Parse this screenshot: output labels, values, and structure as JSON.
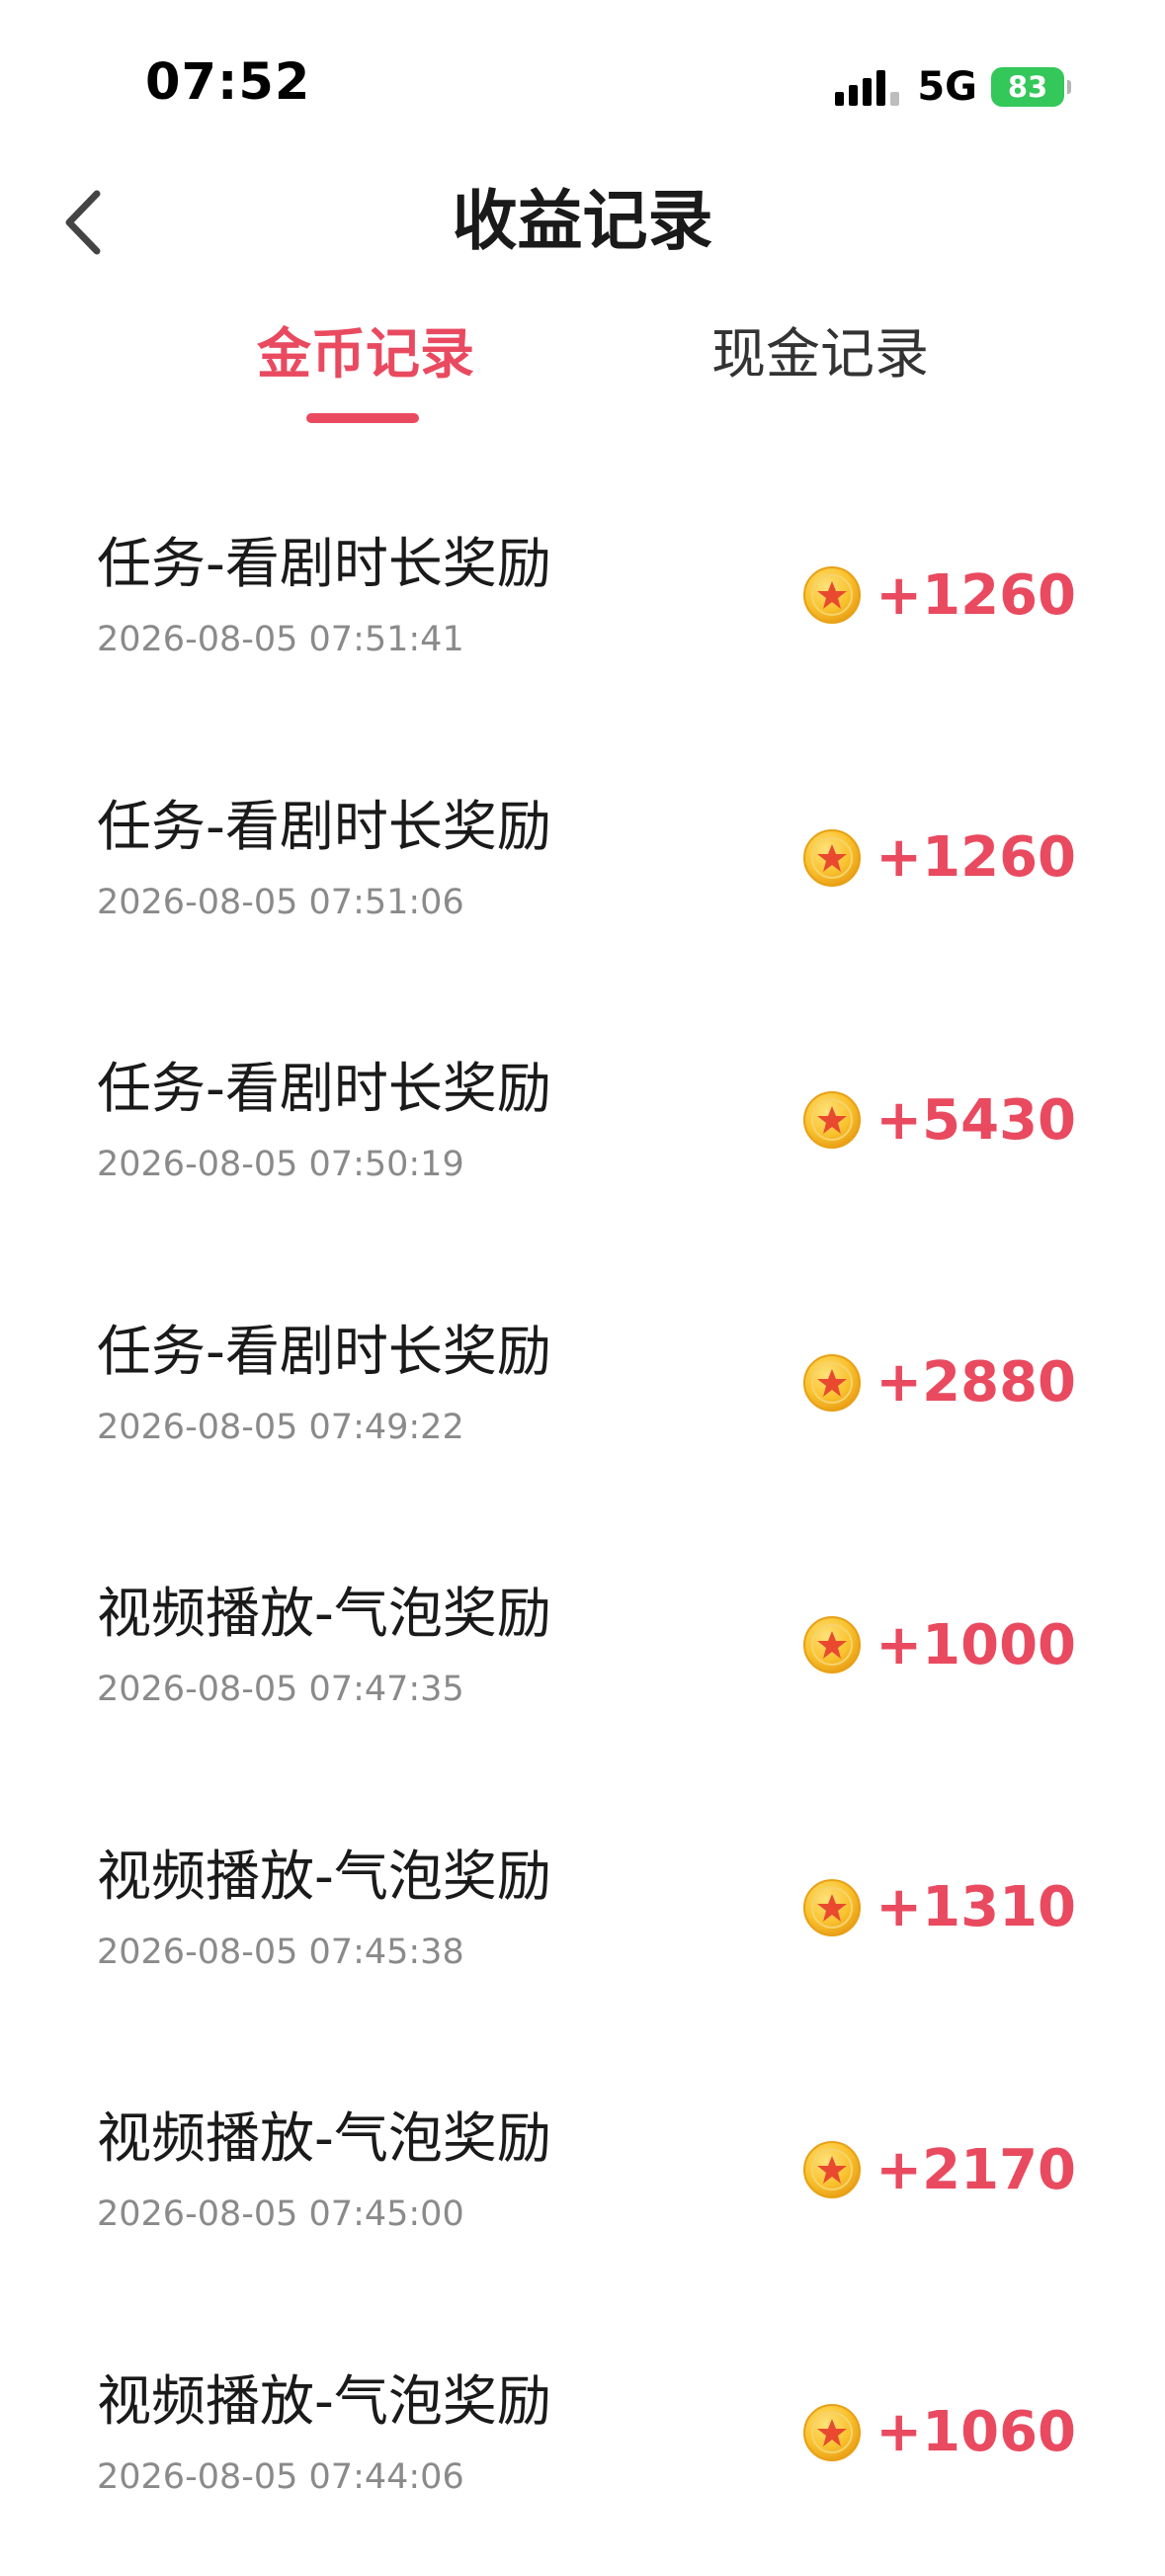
{
  "status_bar": {
    "time": "07:52",
    "network": "5G",
    "battery": "83",
    "signal_icon": "cellular-signal-icon",
    "battery_icon": "battery-charging-icon"
  },
  "header": {
    "title": "收益记录",
    "back_icon": "chevron-left-icon"
  },
  "tabs": [
    {
      "label": "金币记录",
      "active": true
    },
    {
      "label": "现金记录",
      "active": false
    }
  ],
  "colors": {
    "accent": "#e94a5f",
    "coin": "#f7b928",
    "battery": "#34c759"
  },
  "records": [
    {
      "title": "任务-看剧时长奖励",
      "time": "2026-08-05 07:51:41",
      "amount": "+1260"
    },
    {
      "title": "任务-看剧时长奖励",
      "time": "2026-08-05 07:51:06",
      "amount": "+1260"
    },
    {
      "title": "任务-看剧时长奖励",
      "time": "2026-08-05 07:50:19",
      "amount": "+5430"
    },
    {
      "title": "任务-看剧时长奖励",
      "time": "2026-08-05 07:49:22",
      "amount": "+2880"
    },
    {
      "title": "视频播放-气泡奖励",
      "time": "2026-08-05 07:47:35",
      "amount": "+1000"
    },
    {
      "title": "视频播放-气泡奖励",
      "time": "2026-08-05 07:45:38",
      "amount": "+1310"
    },
    {
      "title": "视频播放-气泡奖励",
      "time": "2026-08-05 07:45:00",
      "amount": "+2170"
    },
    {
      "title": "视频播放-气泡奖励",
      "time": "2026-08-05 07:44:06",
      "amount": "+1060"
    }
  ]
}
